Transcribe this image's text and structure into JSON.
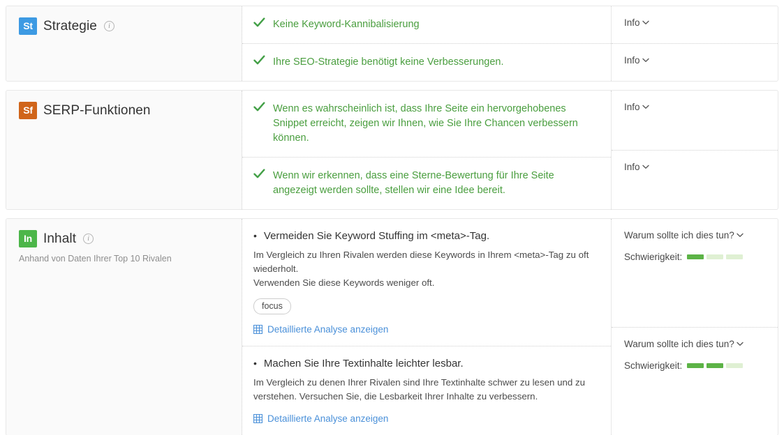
{
  "sections": [
    {
      "key": "strategie",
      "badge": {
        "text": "St",
        "color": "#3d9ae3"
      },
      "title": "Strategie",
      "has_info_icon": true,
      "subtitle": "",
      "rows": [
        {
          "type": "ok",
          "icon": "check-icon",
          "text": "Keine Keyword-Kannibalisierung",
          "side_label": "Info",
          "side_caret": "chevron-down-icon"
        },
        {
          "type": "ok",
          "icon": "check-icon",
          "text": "Ihre SEO-Strategie benötigt keine Verbesserungen.",
          "side_label": "Info",
          "side_caret": "chevron-down-icon"
        }
      ]
    },
    {
      "key": "serp-funktionen",
      "badge": {
        "text": "Sf",
        "color": "#d0651a"
      },
      "title": "SERP-Funktionen",
      "has_info_icon": false,
      "subtitle": "",
      "rows": [
        {
          "type": "ok",
          "icon": "check-icon",
          "text": "Wenn es wahrscheinlich ist, dass Ihre Seite ein hervorgehobenes Snippet erreicht, zeigen wir Ihnen, wie Sie Ihre Chancen verbessern können.",
          "side_label": "Info",
          "side_caret": "chevron-down-icon"
        },
        {
          "type": "ok",
          "icon": "check-icon",
          "text": "Wenn wir erkennen, dass eine Sterne-Bewertung für Ihre Seite angezeigt werden sollte, stellen wir eine Idee bereit.",
          "side_label": "Info",
          "side_caret": "chevron-down-icon"
        }
      ]
    },
    {
      "key": "inhalt",
      "badge": {
        "text": "In",
        "color": "#4cb649"
      },
      "title": "Inhalt",
      "has_info_icon": true,
      "subtitle": "Anhand von Daten Ihrer Top 10 Rivalen",
      "rows": [
        {
          "type": "idea",
          "bullet": "•",
          "title": "Vermeiden Sie Keyword Stuffing im <meta>-Tag.",
          "description": "Im Vergleich zu Ihren Rivalen werden diese Keywords in Ihrem <meta>-Tag zu oft wiederholt.\nVerwenden Sie diese Keywords weniger oft.",
          "tag": "focus",
          "detail_link": "Detaillierte Analyse anzeigen",
          "side_label": "Warum sollte ich dies tun?",
          "side_caret": "chevron-down-icon",
          "difficulty_label": "Schwierigkeit:",
          "difficulty_filled": 1,
          "difficulty_total": 3
        },
        {
          "type": "idea",
          "bullet": "•",
          "title": "Machen Sie Ihre Textinhalte leichter lesbar.",
          "description": "Im Vergleich zu denen Ihrer Rivalen sind Ihre Textinhalte schwer zu lesen und zu verstehen. Versuchen Sie, die Lesbarkeit Ihrer Inhalte zu verbessern.",
          "tag": "",
          "detail_link": "Detaillierte Analyse anzeigen",
          "side_label": "Warum sollte ich dies tun?",
          "side_caret": "chevron-down-icon",
          "difficulty_label": "Schwierigkeit:",
          "difficulty_filled": 2,
          "difficulty_total": 3
        }
      ]
    }
  ],
  "colors": {
    "ok_green": "#4a9e3f",
    "check_green": "#43a047",
    "link_blue": "#4a90d9",
    "bar_on": "#5cb346",
    "bar_off": "#dff0d3"
  }
}
